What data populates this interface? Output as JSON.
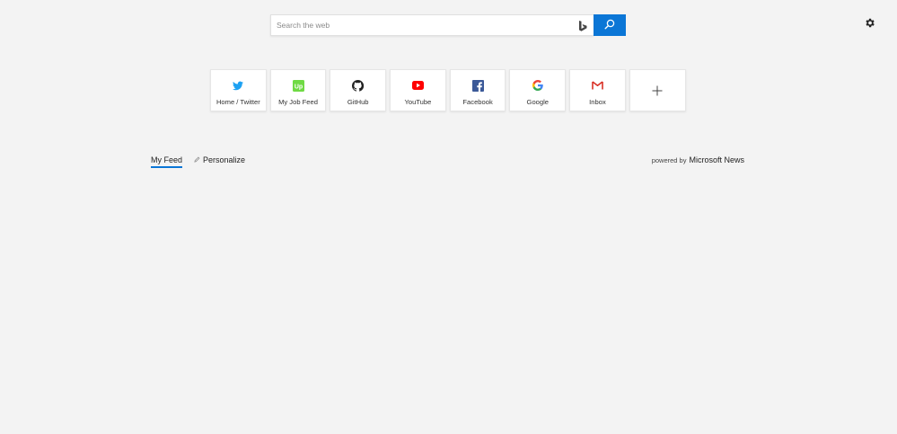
{
  "search": {
    "placeholder": "Search the web"
  },
  "top_sites": [
    {
      "label": "Home / Twitter",
      "icon": "twitter-icon",
      "color": "#1da1f2"
    },
    {
      "label": "My Job Feed",
      "icon": "upwork-icon",
      "color": "#6fda44"
    },
    {
      "label": "GitHub",
      "icon": "github-icon",
      "color": "#222222"
    },
    {
      "label": "YouTube",
      "icon": "youtube-icon",
      "color": "#ff0000"
    },
    {
      "label": "Facebook",
      "icon": "facebook-icon",
      "color": "#3b5998"
    },
    {
      "label": "Google",
      "icon": "google-icon",
      "color": "#4285f4"
    },
    {
      "label": "Inbox",
      "icon": "gmail-icon",
      "color": "#d93025"
    }
  ],
  "add_tile": {
    "icon": "plus-icon"
  },
  "feed": {
    "my_feed_label": "My Feed",
    "personalize_label": "Personalize",
    "powered_prefix": "powered by",
    "powered_brand": "Microsoft News"
  },
  "colors": {
    "accent": "#0b76d6",
    "background": "#f3f3f3"
  }
}
